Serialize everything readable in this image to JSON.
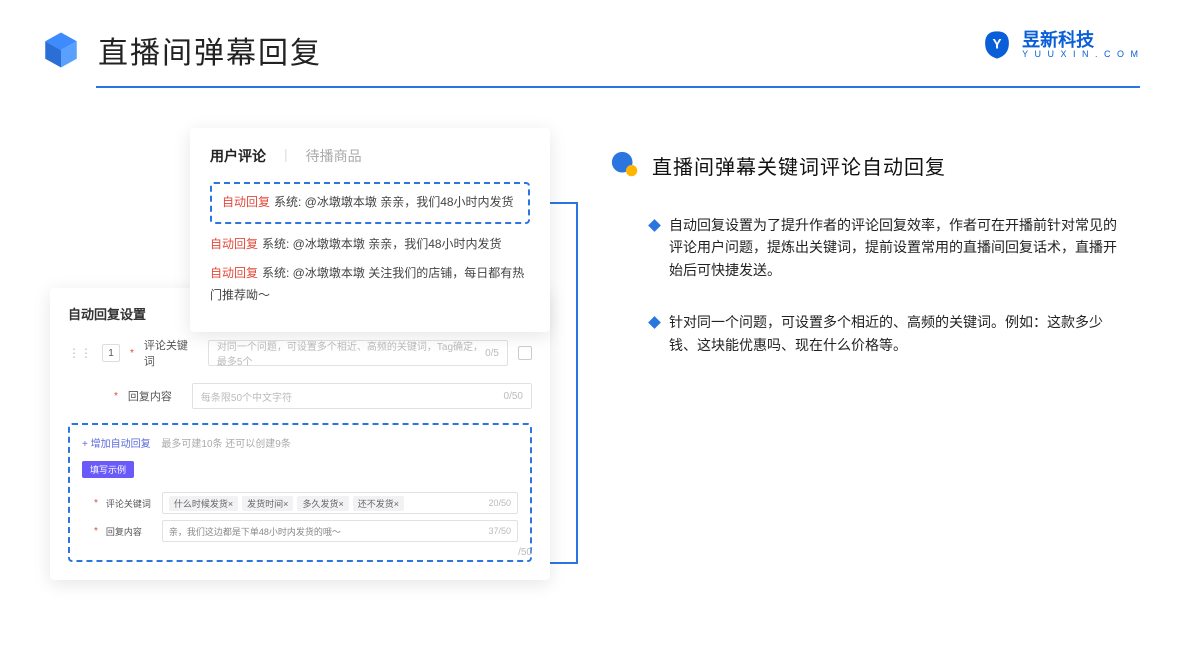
{
  "header": {
    "title": "直播间弹幕回复",
    "brand_cn": "昱新科技",
    "brand_en": "Y U U X I N . C O M"
  },
  "right": {
    "section_title": "直播间弹幕关键词评论自动回复",
    "bullets": [
      "自动回复设置为了提升作者的评论回复效率，作者可在开播前针对常见的评论用户问题，提炼出关键词，提前设置常用的直播间回复话术，直播开始后可快捷发送。",
      "针对同一个问题，可设置多个相近的、高频的关键词。例如：这款多少钱、这块能优惠吗、现在什么价格等。"
    ]
  },
  "card1": {
    "tab_active": "用户评论",
    "tab_inactive": "待播商品",
    "items": [
      {
        "tag": "自动回复",
        "text": "系统: @冰墩墩本墩 亲亲，我们48小时内发货"
      },
      {
        "tag": "自动回复",
        "text": "系统: @冰墩墩本墩 亲亲，我们48小时内发货"
      },
      {
        "tag": "自动回复",
        "text": "系统: @冰墩墩本墩 关注我们的店铺，每日都有热门推荐呦～"
      }
    ]
  },
  "card2": {
    "title": "自动回复设置",
    "rule_index": "1",
    "row1_label": "评论关键词",
    "row1_placeholder": "对同一个问题，可设置多个相近、高频的关键词，Tag确定，最多5个",
    "row1_count": "0/5",
    "row2_label": "回复内容",
    "row2_placeholder": "每条限50个中文字符",
    "row2_count": "0/50",
    "add_text": "+ 增加自动回复",
    "add_hint": "最多可建10条 还可以创建9条",
    "example_badge": "填写示例",
    "ex_kw_label": "评论关键词",
    "ex_kw_tags": [
      "什么时候发货×",
      "发货时间×",
      "多久发货×",
      "还不发货×"
    ],
    "ex_kw_count": "20/50",
    "ex_reply_label": "回复内容",
    "ex_reply_text": "亲，我们这边都是下单48小时内发货的哦～",
    "ex_reply_count": "37/50",
    "ghost_count": "/50"
  }
}
